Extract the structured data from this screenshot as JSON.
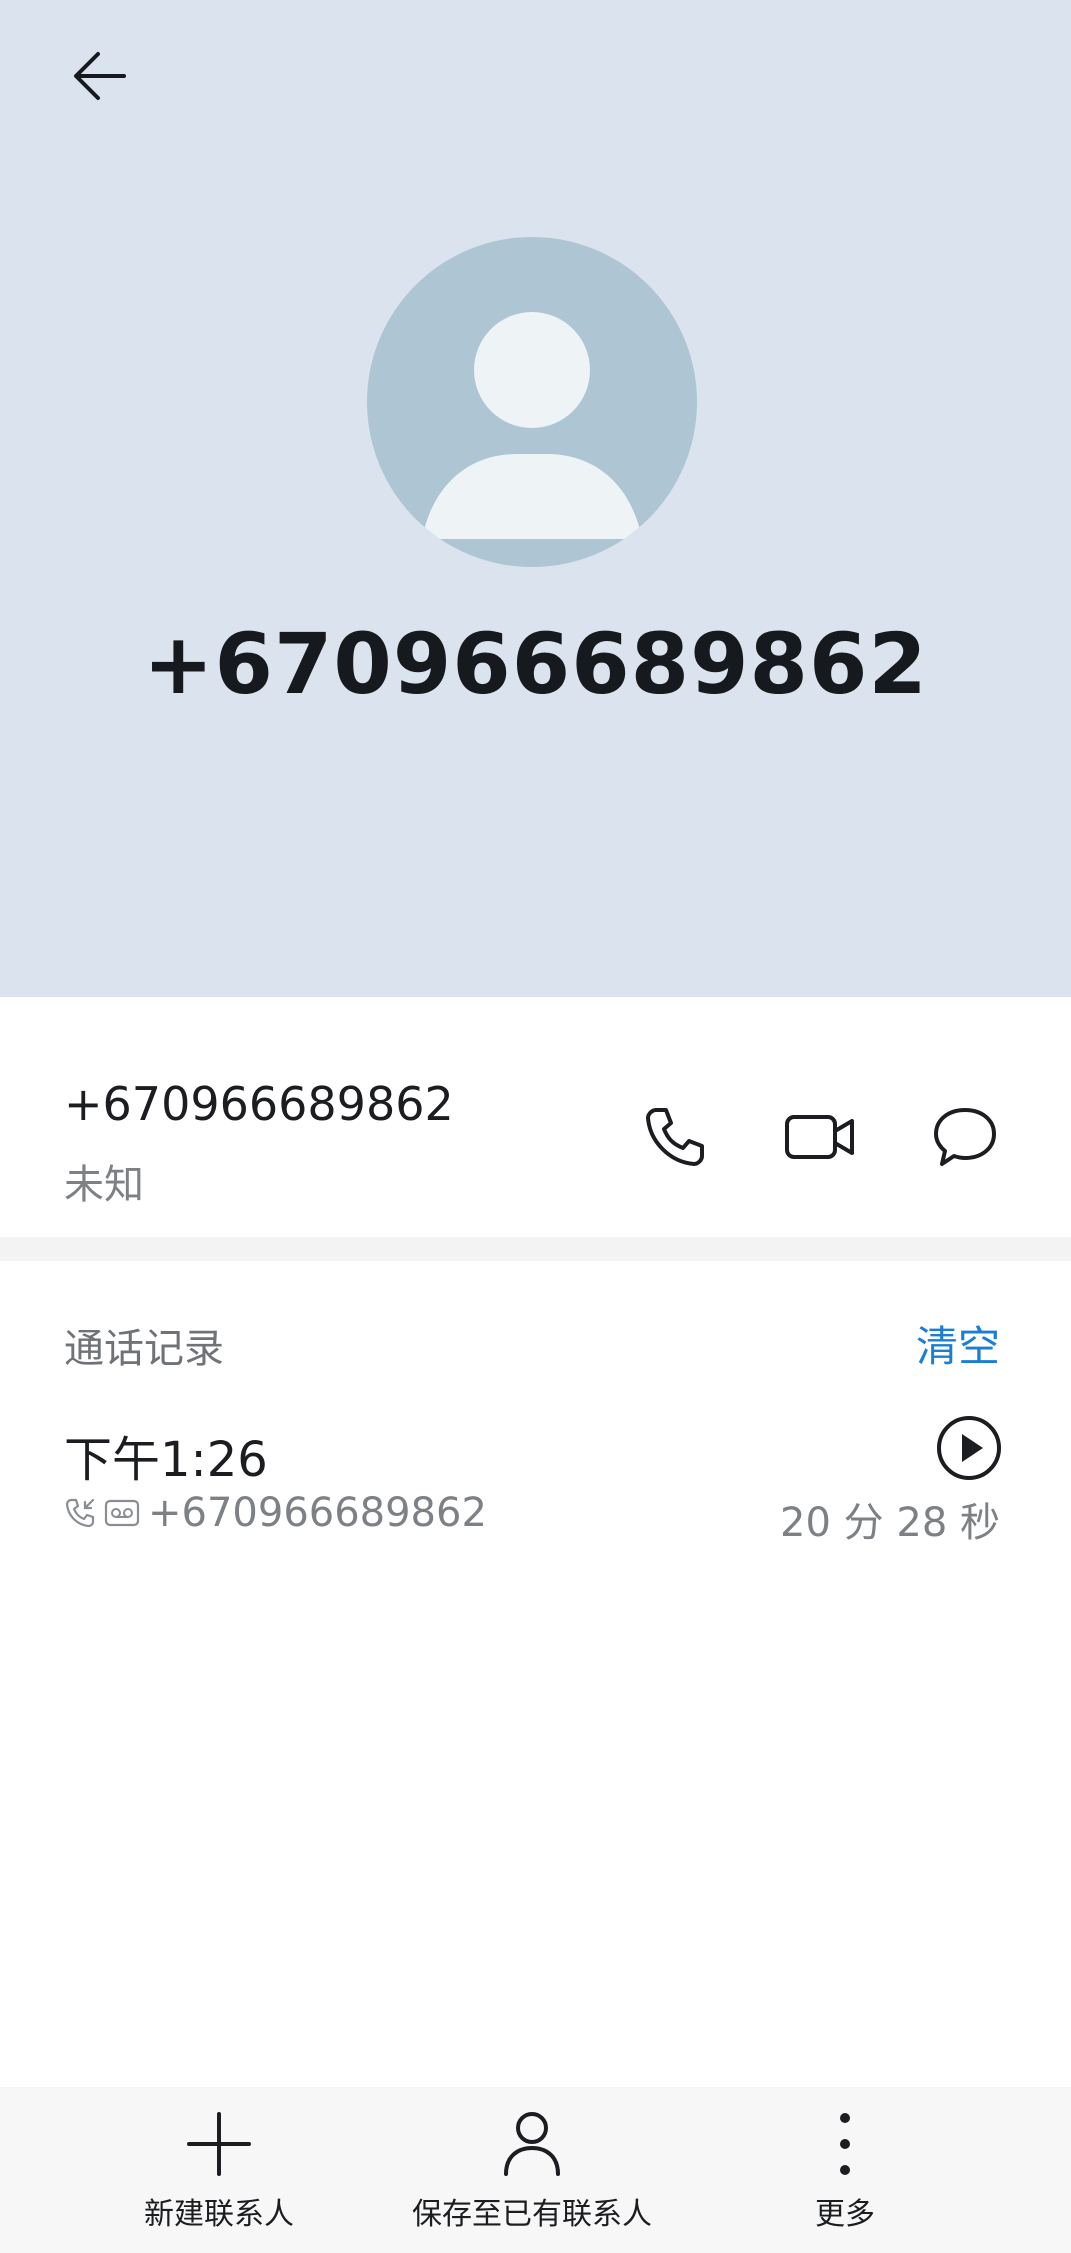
{
  "header": {
    "contact_number": "+670966689862"
  },
  "number_row": {
    "number": "+670966689862",
    "label": "未知"
  },
  "call_log": {
    "title": "通话记录",
    "clear_label": "清空",
    "entries": [
      {
        "time": "下午1:26",
        "number": "+670966689862",
        "duration": "20 分 28 秒"
      }
    ]
  },
  "bottom_bar": {
    "new_contact_label": "新建联系人",
    "save_existing_label": "保存至已有联系人",
    "more_label": "更多"
  },
  "colors": {
    "header_bg": "#dbe4ee",
    "avatar_bg": "#aec5d3",
    "accent": "#1a7fd4"
  }
}
